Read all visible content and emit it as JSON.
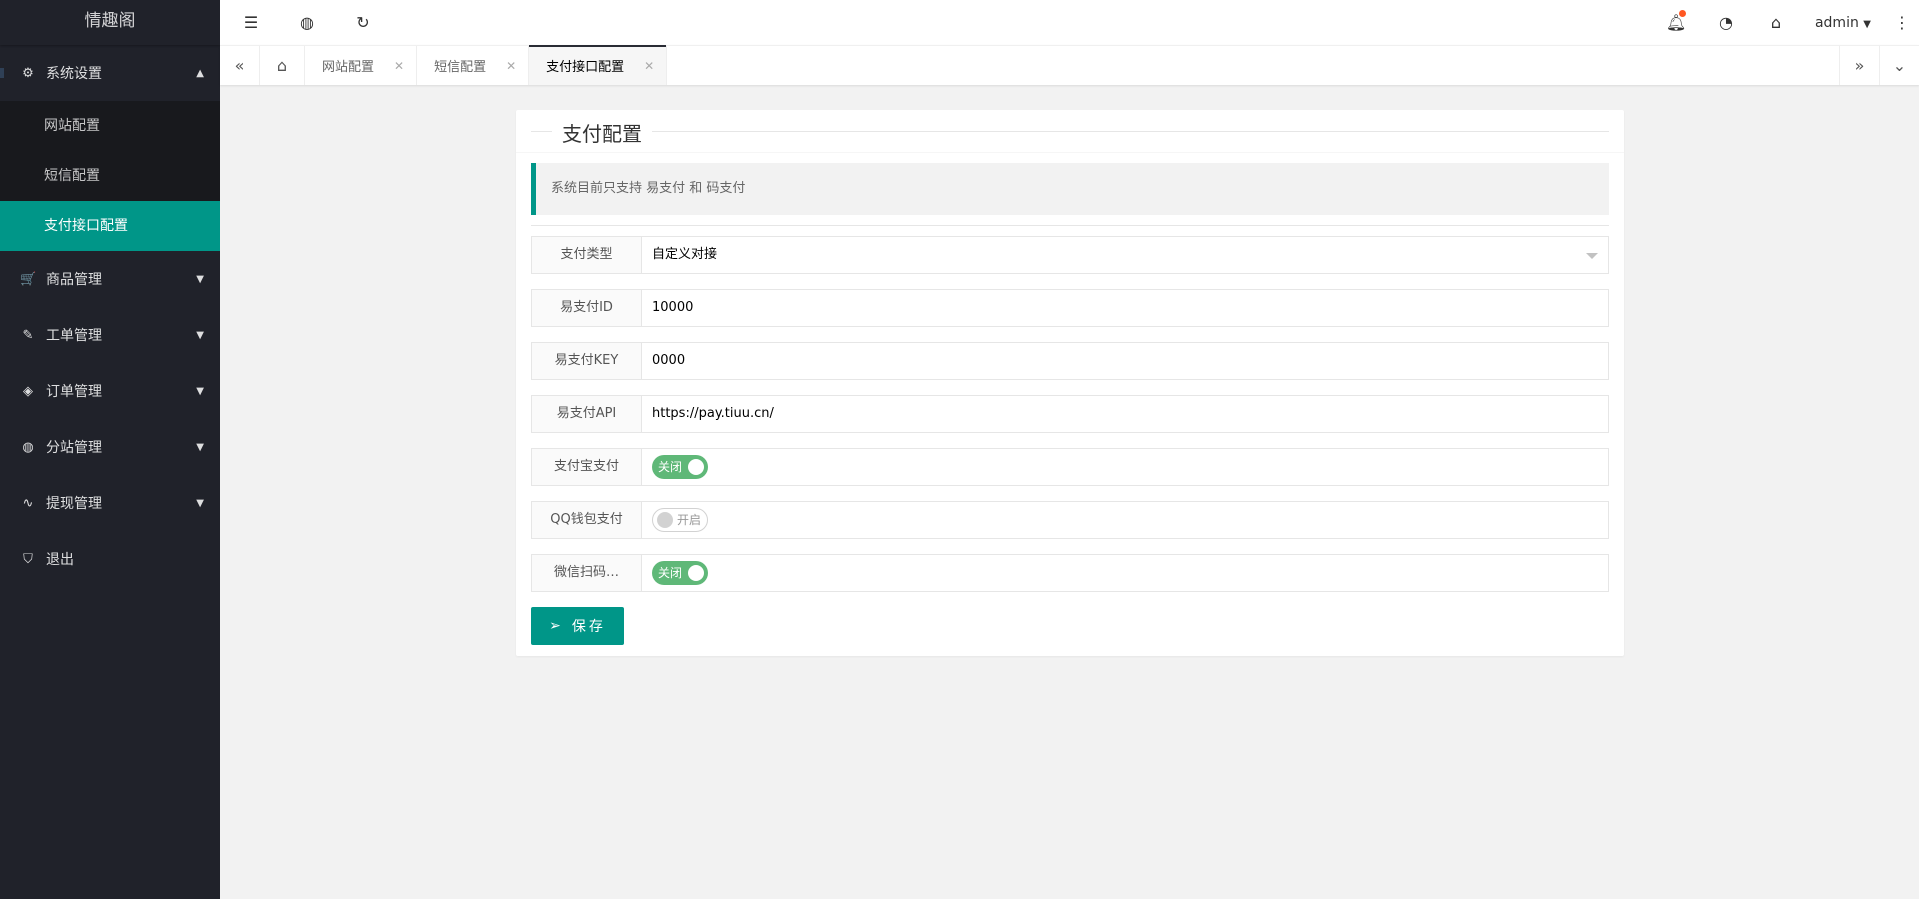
{
  "app": {
    "title": "情趣阁"
  },
  "sidebar": {
    "items": [
      {
        "label": "系统设置",
        "icon": "gear-icon",
        "expanded": true,
        "children": [
          {
            "label": "网站配置"
          },
          {
            "label": "短信配置"
          },
          {
            "label": "支付接口配置",
            "active": true
          }
        ]
      },
      {
        "label": "商品管理",
        "icon": "cart-icon"
      },
      {
        "label": "工单管理",
        "icon": "edit-icon"
      },
      {
        "label": "订单管理",
        "icon": "layers-icon"
      },
      {
        "label": "分站管理",
        "icon": "globe-icon"
      },
      {
        "label": "提现管理",
        "icon": "pulse-icon"
      },
      {
        "label": "退出",
        "icon": "shield-icon"
      }
    ]
  },
  "header": {
    "user": "admin"
  },
  "tabs": [
    {
      "label": "网站配置"
    },
    {
      "label": "短信配置"
    },
    {
      "label": "支付接口配置",
      "active": true
    }
  ],
  "card": {
    "title": "支付配置",
    "notice": "系统目前只支持 易支付 和 码支付",
    "fields": [
      {
        "label": "支付类型",
        "value": "自定义对接"
      },
      {
        "label": "易支付ID",
        "value": "10000"
      },
      {
        "label": "易支付KEY",
        "value": "0000"
      },
      {
        "label": "易支付API",
        "value": "https://pay.tiuu.cn/"
      },
      {
        "label": "支付宝支付",
        "switch": "关闭",
        "on": true
      },
      {
        "label": "QQ钱包支付",
        "switch": "开启",
        "on": false
      },
      {
        "label": "微信扫码…",
        "switch": "关闭",
        "on": true
      }
    ],
    "save": "保存"
  },
  "colors": {
    "accent": "#009688",
    "switch_on": "#5fb878",
    "sidebar": "#20222a"
  }
}
